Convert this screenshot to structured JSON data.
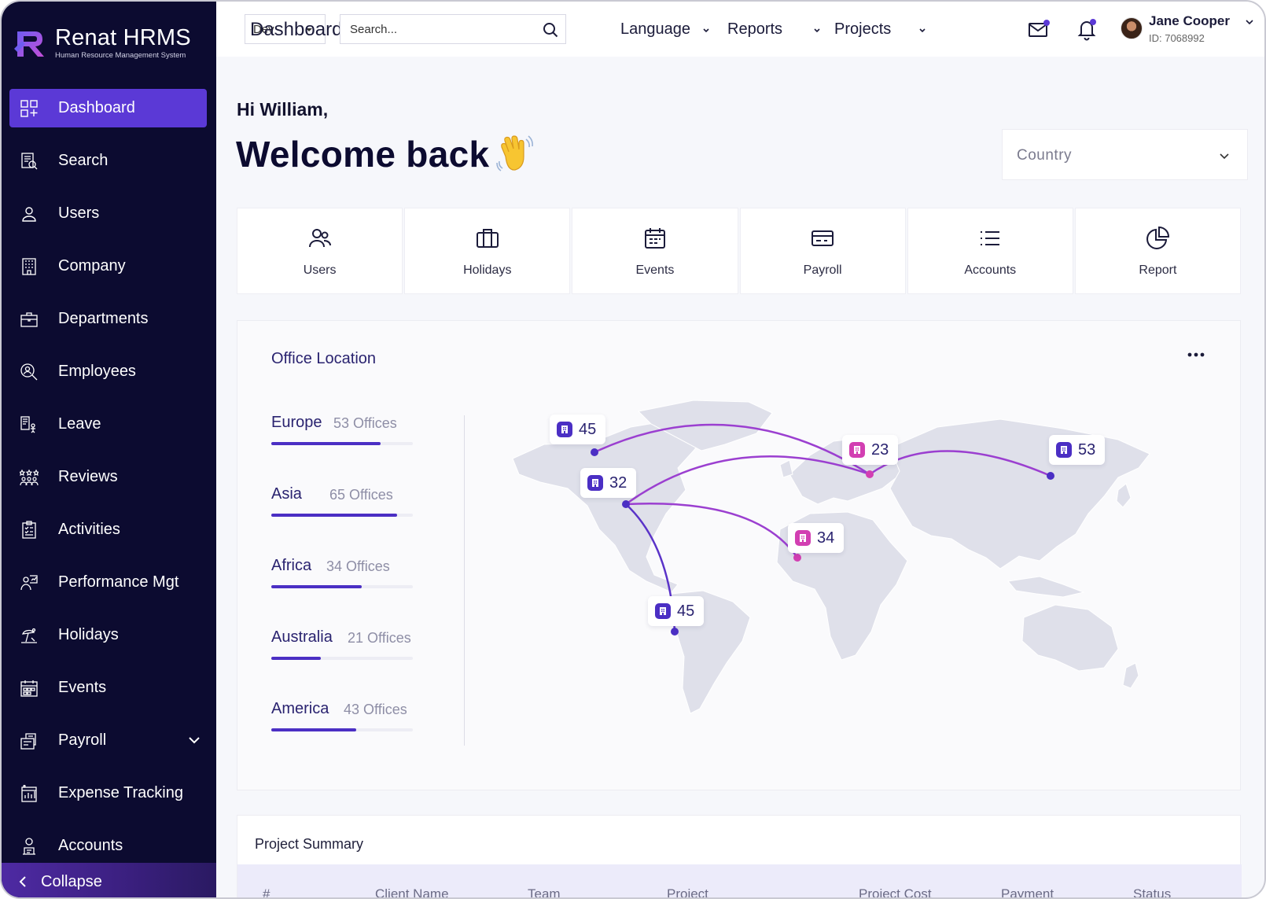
{
  "app": {
    "name": "Renat HRMS",
    "subtitle": "Human Resource Management System"
  },
  "sidebar": {
    "items": [
      {
        "label": "Dashboard",
        "icon": "dashboard-icon",
        "active": true
      },
      {
        "label": "Search",
        "icon": "search-doc-icon"
      },
      {
        "label": "Users",
        "icon": "user-icon"
      },
      {
        "label": "Company",
        "icon": "building-icon"
      },
      {
        "label": "Departments",
        "icon": "briefcase-icon"
      },
      {
        "label": "Employees",
        "icon": "employee-search-icon"
      },
      {
        "label": "Leave",
        "icon": "leave-icon"
      },
      {
        "label": "Reviews",
        "icon": "reviews-icon"
      },
      {
        "label": "Activities",
        "icon": "clipboard-icon"
      },
      {
        "label": "Performance Mgt",
        "icon": "performance-icon"
      },
      {
        "label": "Holidays",
        "icon": "beach-icon"
      },
      {
        "label": "Events",
        "icon": "calendar-icon"
      },
      {
        "label": "Payroll",
        "icon": "payroll-icon",
        "has_submenu": true
      },
      {
        "label": "Expense Tracking",
        "icon": "expense-icon"
      },
      {
        "label": "Accounts",
        "icon": "accounts-icon"
      }
    ],
    "collapse_label": "Collapse"
  },
  "topbar": {
    "page_title": "Dashboard",
    "env_select_value": "Dev",
    "search_placeholder": "Search...",
    "menus": [
      {
        "label": "Language"
      },
      {
        "label": "Reports"
      },
      {
        "label": "Projects"
      }
    ],
    "user": {
      "name": "Jane Cooper",
      "id": "ID: 7068992"
    }
  },
  "greeting": {
    "hi": "Hi William,",
    "welcome": "Welcome back"
  },
  "country_select": {
    "placeholder": "Country"
  },
  "tiles": [
    {
      "label": "Users",
      "icon": "users-icon"
    },
    {
      "label": "Holidays",
      "icon": "briefcase-icon"
    },
    {
      "label": "Events",
      "icon": "calendar-icon"
    },
    {
      "label": "Payroll",
      "icon": "card-icon"
    },
    {
      "label": "Accounts",
      "icon": "list-icon"
    },
    {
      "label": "Report",
      "icon": "pie-chart-icon"
    }
  ],
  "office_location": {
    "title": "Office Location",
    "regions": [
      {
        "name": "Europe",
        "count": "53 Offices",
        "progress": 0.77
      },
      {
        "name": "Asia",
        "count": "65 Offices",
        "progress": 0.89
      },
      {
        "name": "Africa",
        "count": "34 Offices",
        "progress": 0.64
      },
      {
        "name": "Australia",
        "count": "21 Offices",
        "progress": 0.35
      },
      {
        "name": "America",
        "count": "43 Offices",
        "progress": 0.6
      }
    ],
    "map_markers": [
      {
        "value": "45",
        "color": "#4b2fc4"
      },
      {
        "value": "32",
        "color": "#4b2fc4"
      },
      {
        "value": "23",
        "color": "#d23fb2"
      },
      {
        "value": "53",
        "color": "#4b2fc4"
      },
      {
        "value": "34",
        "color": "#d23fb2"
      },
      {
        "value": "45",
        "color": "#4b2fc4"
      }
    ]
  },
  "project_summary": {
    "title": "Project Summary",
    "columns": [
      "#",
      "Client Name",
      "Team",
      "Project",
      "Project Cost",
      "Payment",
      "Status"
    ]
  },
  "colors": {
    "sidebar_bg": "#0c0b30",
    "accent": "#5b39d6",
    "accent_pink": "#d23fb2"
  }
}
